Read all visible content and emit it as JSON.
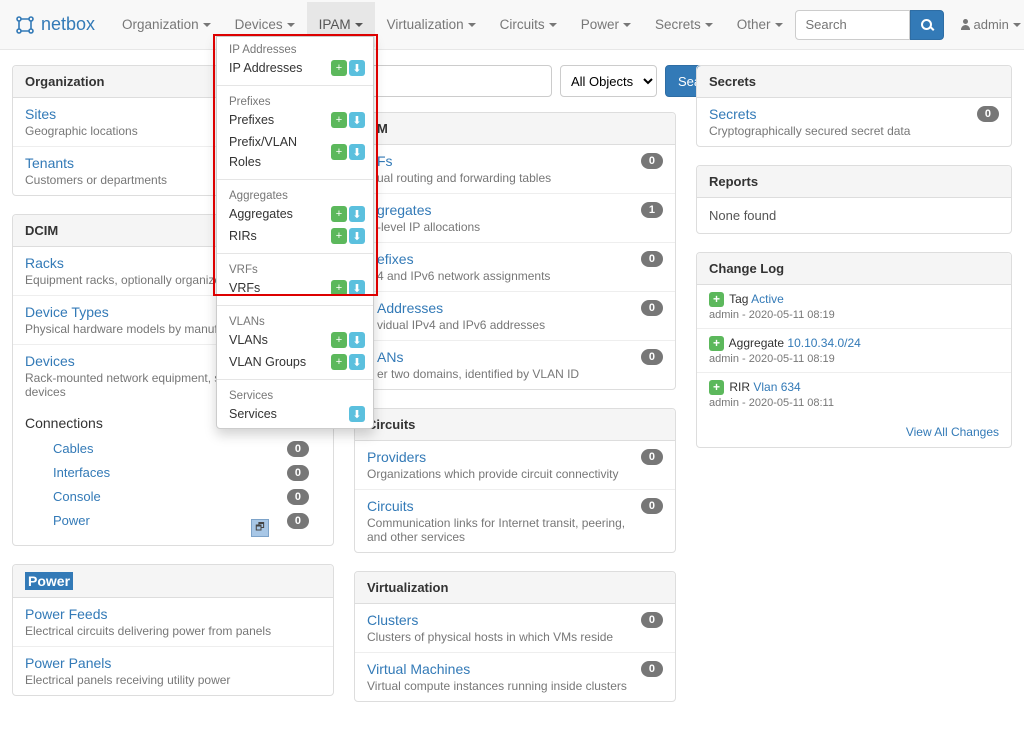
{
  "brand": "netbox",
  "nav": {
    "items": [
      "Organization",
      "Devices",
      "IPAM",
      "Virtualization",
      "Circuits",
      "Power",
      "Secrets",
      "Other"
    ],
    "active_index": 2
  },
  "top_search": {
    "placeholder": "Search",
    "user": "admin"
  },
  "dropdown": {
    "sections": [
      {
        "header": "IP Addresses",
        "links": [
          {
            "label": "IP Addresses",
            "add": true,
            "import": true
          }
        ]
      },
      {
        "header": "Prefixes",
        "links": [
          {
            "label": "Prefixes",
            "add": true,
            "import": true
          },
          {
            "label": "Prefix/VLAN Roles",
            "add": true,
            "import": true
          }
        ]
      },
      {
        "header": "Aggregates",
        "links": [
          {
            "label": "Aggregates",
            "add": true,
            "import": true
          },
          {
            "label": "RIRs",
            "add": true,
            "import": true
          }
        ]
      },
      {
        "header": "VRFs",
        "links": [
          {
            "label": "VRFs",
            "add": true,
            "import": true
          }
        ]
      },
      {
        "header": "VLANs",
        "links": [
          {
            "label": "VLANs",
            "add": true,
            "import": true
          },
          {
            "label": "VLAN Groups",
            "add": true,
            "import": true
          }
        ]
      },
      {
        "header": "Services",
        "links": [
          {
            "label": "Services",
            "add": false,
            "import": true
          }
        ]
      }
    ]
  },
  "main_search": {
    "select": "All Objects",
    "button": "Search"
  },
  "organization": {
    "header": "Organization",
    "items": [
      {
        "title": "Sites",
        "sub": "Geographic locations"
      },
      {
        "title": "Tenants",
        "sub": "Customers or departments"
      }
    ]
  },
  "dcim": {
    "header": "DCIM",
    "items": [
      {
        "title": "Racks",
        "sub": "Equipment racks, optionally organized by group"
      },
      {
        "title": "Device Types",
        "sub": "Physical hardware models by manufacturer"
      },
      {
        "title": "Devices",
        "sub": "Rack-mounted network equipment, servers, and other devices"
      }
    ],
    "connections": {
      "title": "Connections",
      "items": [
        {
          "label": "Cables",
          "count": "0"
        },
        {
          "label": "Interfaces",
          "count": "0"
        },
        {
          "label": "Console",
          "count": "0"
        },
        {
          "label": "Power",
          "count": "0"
        }
      ]
    }
  },
  "power": {
    "header": "Power",
    "items": [
      {
        "title": "Power Feeds",
        "sub": "Electrical circuits delivering power from panels"
      },
      {
        "title": "Power Panels",
        "sub": "Electrical panels receiving utility power"
      }
    ]
  },
  "ipam": {
    "header": "M",
    "items": [
      {
        "title": "Fs",
        "sub": "ual routing and forwarding tables",
        "count": "0"
      },
      {
        "title": "gregates",
        "sub": "-level IP allocations",
        "count": "1"
      },
      {
        "title": "efixes",
        "sub": "4 and IPv6 network assignments",
        "count": "0"
      },
      {
        "title": "Addresses",
        "sub": "vidual IPv4 and IPv6 addresses",
        "count": "0"
      },
      {
        "title": "ANs",
        "sub": "er two domains, identified by VLAN ID",
        "count": "0"
      }
    ]
  },
  "circuits": {
    "header": "Circuits",
    "items": [
      {
        "title": "Providers",
        "sub": "Organizations which provide circuit connectivity",
        "count": "0"
      },
      {
        "title": "Circuits",
        "sub": "Communication links for Internet transit, peering, and other services",
        "count": "0"
      }
    ]
  },
  "virtualization": {
    "header": "Virtualization",
    "items": [
      {
        "title": "Clusters",
        "sub": "Clusters of physical hosts in which VMs reside",
        "count": "0"
      },
      {
        "title": "Virtual Machines",
        "sub": "Virtual compute instances running inside clusters",
        "count": "0"
      }
    ]
  },
  "secrets": {
    "header": "Secrets",
    "items": [
      {
        "title": "Secrets",
        "sub": "Cryptographically secured secret data",
        "count": "0"
      }
    ]
  },
  "reports": {
    "header": "Reports",
    "none": "None found"
  },
  "changelog": {
    "header": "Change Log",
    "items": [
      {
        "type": "Tag",
        "obj": "Active",
        "user": "admin",
        "ts": "2020-05-11 08:19"
      },
      {
        "type": "Aggregate",
        "obj": "10.10.34.0/24",
        "user": "admin",
        "ts": "2020-05-11 08:19"
      },
      {
        "type": "RIR",
        "obj": "Vlan 634",
        "user": "admin",
        "ts": "2020-05-11 08:11"
      }
    ],
    "view_all": "View All Changes"
  }
}
